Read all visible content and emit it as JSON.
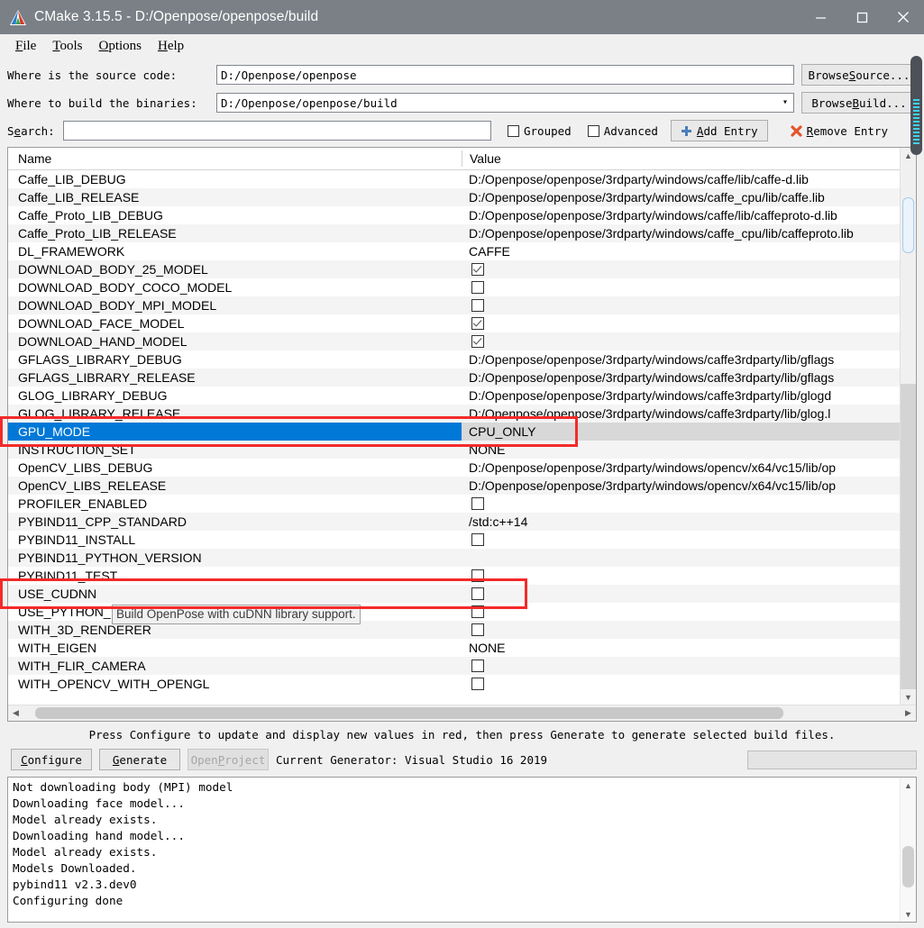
{
  "window": {
    "title": "CMake 3.15.5 - D:/Openpose/openpose/build",
    "minimize_label": "minimize",
    "maximize_label": "maximize",
    "close_label": "close"
  },
  "menu": [
    {
      "label": "File",
      "accel": "F"
    },
    {
      "label": "Tools",
      "accel": "T"
    },
    {
      "label": "Options",
      "accel": "O"
    },
    {
      "label": "Help",
      "accel": "H"
    }
  ],
  "form": {
    "source_label": "Where is the source code:",
    "source_value": "D:/Openpose/openpose",
    "browse_source": "Browse Source...",
    "browse_source_accel": "S",
    "build_label": "Where to build the binaries:",
    "build_value": "D:/Openpose/openpose/build",
    "browse_build": "Browse Build...",
    "browse_build_accel": "B",
    "search_label": "Search:",
    "search_value": "",
    "search_placeholder": "",
    "grouped_label": "Grouped",
    "grouped_checked": false,
    "advanced_label": "Advanced",
    "advanced_checked": false,
    "add_entry_label": "Add Entry",
    "add_entry_accel": "A",
    "remove_entry_label": "Remove Entry",
    "remove_entry_accel": "R"
  },
  "table": {
    "col_name": "Name",
    "col_value": "Value",
    "rows": [
      {
        "name": "Caffe_LIB_DEBUG",
        "value": "D:/Openpose/openpose/3rdparty/windows/caffe/lib/caffe-d.lib",
        "type": "text"
      },
      {
        "name": "Caffe_LIB_RELEASE",
        "value": "D:/Openpose/openpose/3rdparty/windows/caffe_cpu/lib/caffe.lib",
        "type": "text"
      },
      {
        "name": "Caffe_Proto_LIB_DEBUG",
        "value": "D:/Openpose/openpose/3rdparty/windows/caffe/lib/caffeproto-d.lib",
        "type": "text"
      },
      {
        "name": "Caffe_Proto_LIB_RELEASE",
        "value": "D:/Openpose/openpose/3rdparty/windows/caffe_cpu/lib/caffeproto.lib",
        "type": "text"
      },
      {
        "name": "DL_FRAMEWORK",
        "value": "CAFFE",
        "type": "text"
      },
      {
        "name": "DOWNLOAD_BODY_25_MODEL",
        "value": "",
        "type": "checkbox",
        "checked": true
      },
      {
        "name": "DOWNLOAD_BODY_COCO_MODEL",
        "value": "",
        "type": "checkbox",
        "checked": false
      },
      {
        "name": "DOWNLOAD_BODY_MPI_MODEL",
        "value": "",
        "type": "checkbox",
        "checked": false
      },
      {
        "name": "DOWNLOAD_FACE_MODEL",
        "value": "",
        "type": "checkbox",
        "checked": true
      },
      {
        "name": "DOWNLOAD_HAND_MODEL",
        "value": "",
        "type": "checkbox",
        "checked": true
      },
      {
        "name": "GFLAGS_LIBRARY_DEBUG",
        "value": "D:/Openpose/openpose/3rdparty/windows/caffe3rdparty/lib/gflags",
        "type": "text"
      },
      {
        "name": "GFLAGS_LIBRARY_RELEASE",
        "value": "D:/Openpose/openpose/3rdparty/windows/caffe3rdparty/lib/gflags",
        "type": "text"
      },
      {
        "name": "GLOG_LIBRARY_DEBUG",
        "value": "D:/Openpose/openpose/3rdparty/windows/caffe3rdparty/lib/glogd",
        "type": "text"
      },
      {
        "name": "GLOG_LIBRARY_RELEASE",
        "value": "D:/Openpose/openpose/3rdparty/windows/caffe3rdparty/lib/glog.l",
        "type": "text"
      },
      {
        "name": "GPU_MODE",
        "value": "CPU_ONLY",
        "type": "text",
        "selected": true
      },
      {
        "name": "INSTRUCTION_SET",
        "value": "NONE",
        "type": "text"
      },
      {
        "name": "OpenCV_LIBS_DEBUG",
        "value": "D:/Openpose/openpose/3rdparty/windows/opencv/x64/vc15/lib/op",
        "type": "text"
      },
      {
        "name": "OpenCV_LIBS_RELEASE",
        "value": "D:/Openpose/openpose/3rdparty/windows/opencv/x64/vc15/lib/op",
        "type": "text"
      },
      {
        "name": "PROFILER_ENABLED",
        "value": "",
        "type": "checkbox",
        "checked": false
      },
      {
        "name": "PYBIND11_CPP_STANDARD",
        "value": "/std:c++14",
        "type": "text"
      },
      {
        "name": "PYBIND11_INSTALL",
        "value": "",
        "type": "checkbox",
        "checked": false
      },
      {
        "name": "PYBIND11_PYTHON_VERSION",
        "value": "",
        "type": "text"
      },
      {
        "name": "PYBIND11_TEST",
        "value": "",
        "type": "checkbox",
        "checked": false
      },
      {
        "name": "USE_CUDNN",
        "value": "",
        "type": "checkbox",
        "checked": false
      },
      {
        "name": "USE_PYTHON_I",
        "value": "",
        "type": "checkbox",
        "checked": false
      },
      {
        "name": "WITH_3D_RENDERER",
        "value": "",
        "type": "checkbox",
        "checked": false
      },
      {
        "name": "WITH_EIGEN",
        "value": "NONE",
        "type": "text"
      },
      {
        "name": "WITH_FLIR_CAMERA",
        "value": "",
        "type": "checkbox",
        "checked": false
      },
      {
        "name": "WITH_OPENCV_WITH_OPENGL",
        "value": "",
        "type": "checkbox",
        "checked": false
      }
    ]
  },
  "tooltip": {
    "text": "Build OpenPose with cuDNN library support."
  },
  "bottom": {
    "hint": "Press Configure to update and display new values in red, then press Generate to generate selected build files.",
    "configure_label": "Configure",
    "configure_accel": "C",
    "generate_label": "Generate",
    "generate_accel": "G",
    "open_project_label": "Open Project",
    "open_project_accel": "P",
    "generator_text": "Current Generator: Visual Studio 16 2019"
  },
  "log": {
    "lines": [
      "Not downloading body (MPI) model",
      "Downloading face model...",
      "Model already exists.",
      "Downloading hand model...",
      "Model already exists.",
      "Models Downloaded.",
      "pybind11 v2.3.dev0",
      "Configuring done"
    ]
  },
  "colors": {
    "titlebar": "#7a8086",
    "selection": "#0078d7",
    "highlight_box": "#f42a2a"
  }
}
